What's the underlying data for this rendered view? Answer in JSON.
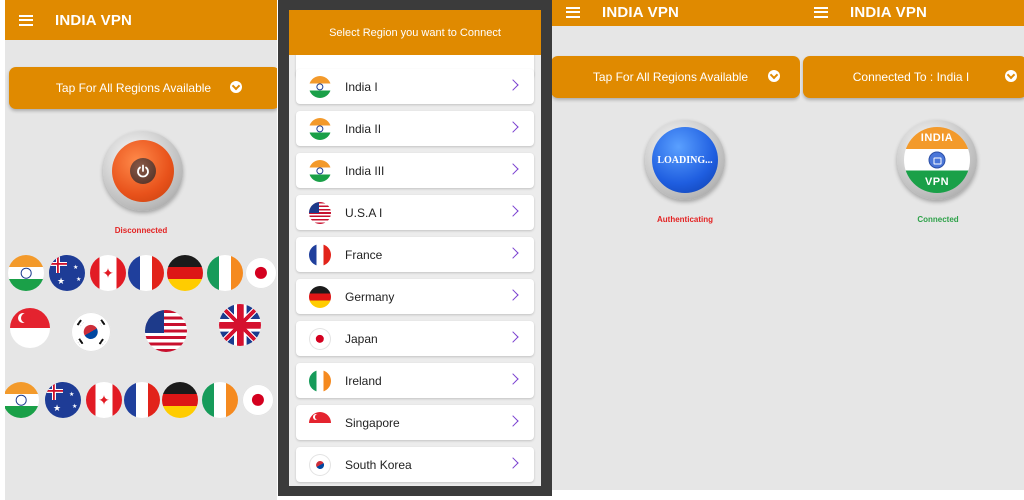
{
  "colors": {
    "accent": "#e08a00",
    "disconnected": "#e32323",
    "authenticating": "#e32323",
    "connected": "#2fa24a",
    "chevron": "#7a3fd0"
  },
  "panel1": {
    "title": "INDIA VPN",
    "region_button": "Tap For All Regions Available",
    "status": "Disconnected",
    "power_icon": "power-icon",
    "flags": [
      "india",
      "australia",
      "canada",
      "france",
      "germany",
      "ireland",
      "japan",
      "singapore",
      "south-korea",
      "usa",
      "uk",
      "india",
      "australia",
      "canada",
      "france",
      "germany",
      "ireland",
      "japan"
    ]
  },
  "panel2": {
    "dialog_title": "Select Region you want to Connect",
    "regions": [
      {
        "name": "India I",
        "flag": "india"
      },
      {
        "name": "India II",
        "flag": "india"
      },
      {
        "name": "India III",
        "flag": "india"
      },
      {
        "name": "U.S.A I",
        "flag": "usa"
      },
      {
        "name": "France",
        "flag": "france"
      },
      {
        "name": "Germany",
        "flag": "germany"
      },
      {
        "name": "Japan",
        "flag": "japan"
      },
      {
        "name": "Ireland",
        "flag": "ireland"
      },
      {
        "name": "Singapore",
        "flag": "singapore"
      },
      {
        "name": "South Korea",
        "flag": "south-korea"
      }
    ]
  },
  "panel3": {
    "title": "INDIA VPN",
    "region_button": "Tap For All Regions Available",
    "loading_text": "LOADING...",
    "status": "Authenticating"
  },
  "panel4": {
    "title": "INDIA VPN",
    "region_button": "Connected To : India I",
    "badge_top": "INDIA",
    "badge_bottom": "VPN",
    "status": "Connected"
  }
}
